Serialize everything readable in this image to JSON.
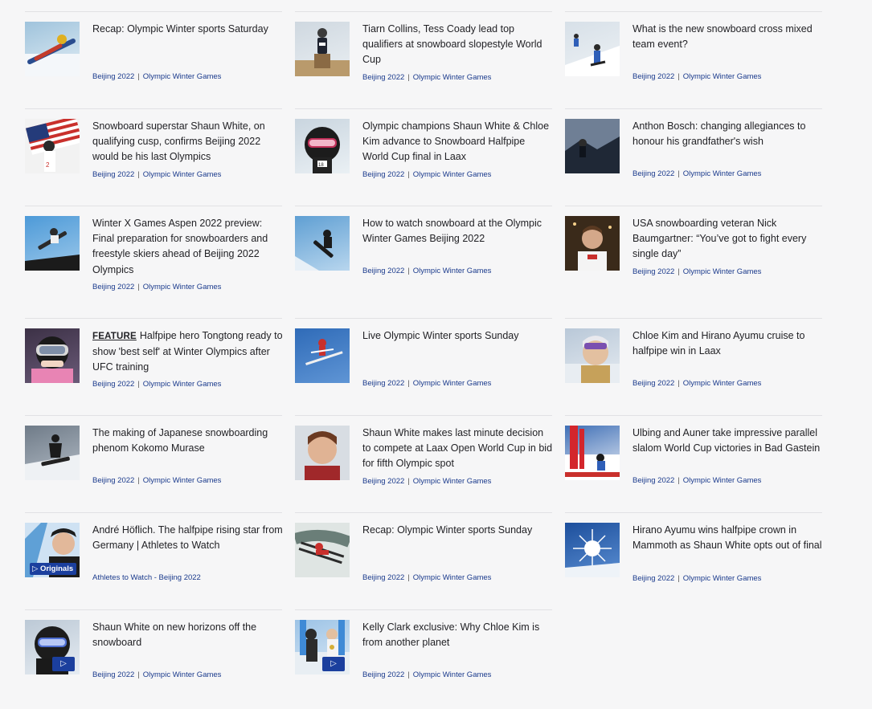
{
  "articles": [
    {
      "id": "a1",
      "title": "Recap: Olympic Winter sports Saturday",
      "tags": [
        "Beijing 2022",
        "Olympic Winter Games"
      ],
      "scene": "luge",
      "icon": "luge-icon",
      "colors": [
        "#9fc3dc",
        "#e2eef5"
      ]
    },
    {
      "id": "a2",
      "title": "Tiarn Collins, Tess Coady lead top qualifiers at snowboard slopestyle World Cup",
      "tags": [
        "Beijing 2022",
        "Olympic Winter Games"
      ],
      "scene": "podium",
      "icon": "podium-icon",
      "colors": [
        "#cfd8e0",
        "#e9eef2"
      ]
    },
    {
      "id": "a3",
      "title": "What is the new snowboard cross mixed team event?",
      "tags": [
        "Beijing 2022",
        "Olympic Winter Games"
      ],
      "scene": "cross",
      "icon": "snowboard-cross-icon",
      "colors": [
        "#d7e0e8",
        "#eef2f5"
      ]
    },
    {
      "id": "a4",
      "title": "Snowboard superstar Shaun White, on qualifying cusp, confirms Beijing 2022 would be his last Olympics",
      "tags": [
        "Beijing 2022",
        "Olympic Winter Games"
      ],
      "scene": "flag",
      "icon": "flag-icon",
      "colors": [
        "#dcdfe6",
        "#f0f0f3"
      ]
    },
    {
      "id": "a5",
      "title": "Olympic champions Shaun White & Chloe Kim advance to Snowboard Halfpipe World Cup final in Laax",
      "tags": [
        "Beijing 2022",
        "Olympic Winter Games"
      ],
      "scene": "helmet",
      "icon": "helmet-icon",
      "colors": [
        "#c9d5df",
        "#eaf0f4"
      ]
    },
    {
      "id": "a6",
      "title": "Anthon Bosch: changing allegiances to honour his grandfather's wish",
      "tags": [
        "Beijing 2022",
        "Olympic Winter Games"
      ],
      "scene": "dusk",
      "icon": "mountain-icon",
      "colors": [
        "#3b4a5e",
        "#8c98a8"
      ]
    },
    {
      "id": "a7",
      "title": "Winter X Games Aspen 2022 preview: Final preparation for snowboarders and freestyle skiers ahead of Beijing 2022 Olympics",
      "tags": [
        "Beijing 2022",
        "Olympic Winter Games"
      ],
      "scene": "air",
      "icon": "snowboarder-icon",
      "colors": [
        "#4d9ad8",
        "#9cc8ea"
      ]
    },
    {
      "id": "a8",
      "title": "How to watch snowboard at the Olympic Winter Games Beijing 2022",
      "tags": [
        "Beijing 2022",
        "Olympic Winter Games"
      ],
      "scene": "air2",
      "icon": "snowboarder-icon",
      "colors": [
        "#5f9fd3",
        "#b8d6ee"
      ]
    },
    {
      "id": "a9",
      "title": "USA snowboarding veteran Nick Baumgartner: “You’ve got to fight every single day”",
      "tags": [
        "Beijing 2022",
        "Olympic Winter Games"
      ],
      "scene": "portrait",
      "icon": "athlete-icon",
      "colors": [
        "#7a5a3c",
        "#b08a5c"
      ]
    },
    {
      "id": "a10",
      "feature": "FEATURE",
      "title": "Halfpipe hero Tongtong ready to show 'best self' at Winter Olympics after UFC training",
      "tags": [
        "Beijing 2022",
        "Olympic Winter Games"
      ],
      "scene": "goggles",
      "icon": "goggles-icon",
      "colors": [
        "#3c3146",
        "#6a5a78"
      ]
    },
    {
      "id": "a11",
      "title": "Live Olympic Winter sports Sunday",
      "tags": [
        "Beijing 2022",
        "Olympic Winter Games"
      ],
      "scene": "ski",
      "icon": "skier-icon",
      "colors": [
        "#2f6bb8",
        "#5f95d5"
      ]
    },
    {
      "id": "a12",
      "title": "Chloe Kim and Hirano Ayumu cruise to halfpipe win in Laax",
      "tags": [
        "Beijing 2022",
        "Olympic Winter Games"
      ],
      "scene": "smile",
      "icon": "athlete-icon",
      "colors": [
        "#b9c8d8",
        "#e5ebf1"
      ]
    },
    {
      "id": "a13",
      "title": "The making of Japanese snowboarding phenom Kokomo Murase",
      "tags": [
        "Beijing 2022",
        "Olympic Winter Games"
      ],
      "scene": "ride",
      "icon": "snowboarder-icon",
      "colors": [
        "#6f7b88",
        "#b3bcc6"
      ]
    },
    {
      "id": "a14",
      "title": "Shaun White makes last minute decision to compete at Laax Open World Cup in bid for fifth Olympic spot",
      "tags": [
        "Beijing 2022",
        "Olympic Winter Games"
      ],
      "scene": "face",
      "icon": "athlete-icon",
      "colors": [
        "#c69a7c",
        "#e3c4ac"
      ]
    },
    {
      "id": "a15",
      "title": "Ulbing and Auner take impressive parallel slalom World Cup victories in Bad Gastein",
      "tags": [
        "Beijing 2022",
        "Olympic Winter Games"
      ],
      "scene": "slalom",
      "icon": "slalom-icon",
      "colors": [
        "#3f6fb6",
        "#e9eef6"
      ]
    },
    {
      "id": "a16",
      "title": "André Höflich. The halfpipe rising star from Germany | Athletes to Watch",
      "tags": [
        "Athletes to Watch - Beijing 2022"
      ],
      "scene": "originals",
      "icon": "athlete-icon",
      "badge": "▷ Originals",
      "colors": [
        "#3f7fc8",
        "#a9cbe9"
      ]
    },
    {
      "id": "a17",
      "title": "Recap: Olympic Winter sports Sunday",
      "tags": [
        "Beijing 2022",
        "Olympic Winter Games"
      ],
      "scene": "jump",
      "icon": "ski-jump-icon",
      "colors": [
        "#6a7e78",
        "#c8d2cf"
      ]
    },
    {
      "id": "a18",
      "title": "Hirano Ayumu wins halfpipe crown in Mammoth as Shaun White opts out of final",
      "tags": [
        "Beijing 2022",
        "Olympic Winter Games"
      ],
      "scene": "sun",
      "icon": "sun-icon",
      "colors": [
        "#1d4f9c",
        "#5b8fd3"
      ]
    },
    {
      "id": "a19",
      "title": "Shaun White on new horizons off the snowboard",
      "tags": [
        "Beijing 2022",
        "Olympic Winter Games"
      ],
      "scene": "helmet2",
      "icon": "helmet-icon",
      "play": "▷",
      "colors": [
        "#bcc9d6",
        "#e6ecf2"
      ]
    },
    {
      "id": "a20",
      "title": "Kelly Clark exclusive: Why Chloe Kim is from another planet",
      "tags": [
        "Beijing 2022",
        "Olympic Winter Games"
      ],
      "scene": "medal",
      "icon": "medal-icon",
      "play": "▷",
      "colors": [
        "#9cc3e6",
        "#dbe9f5"
      ]
    }
  ]
}
